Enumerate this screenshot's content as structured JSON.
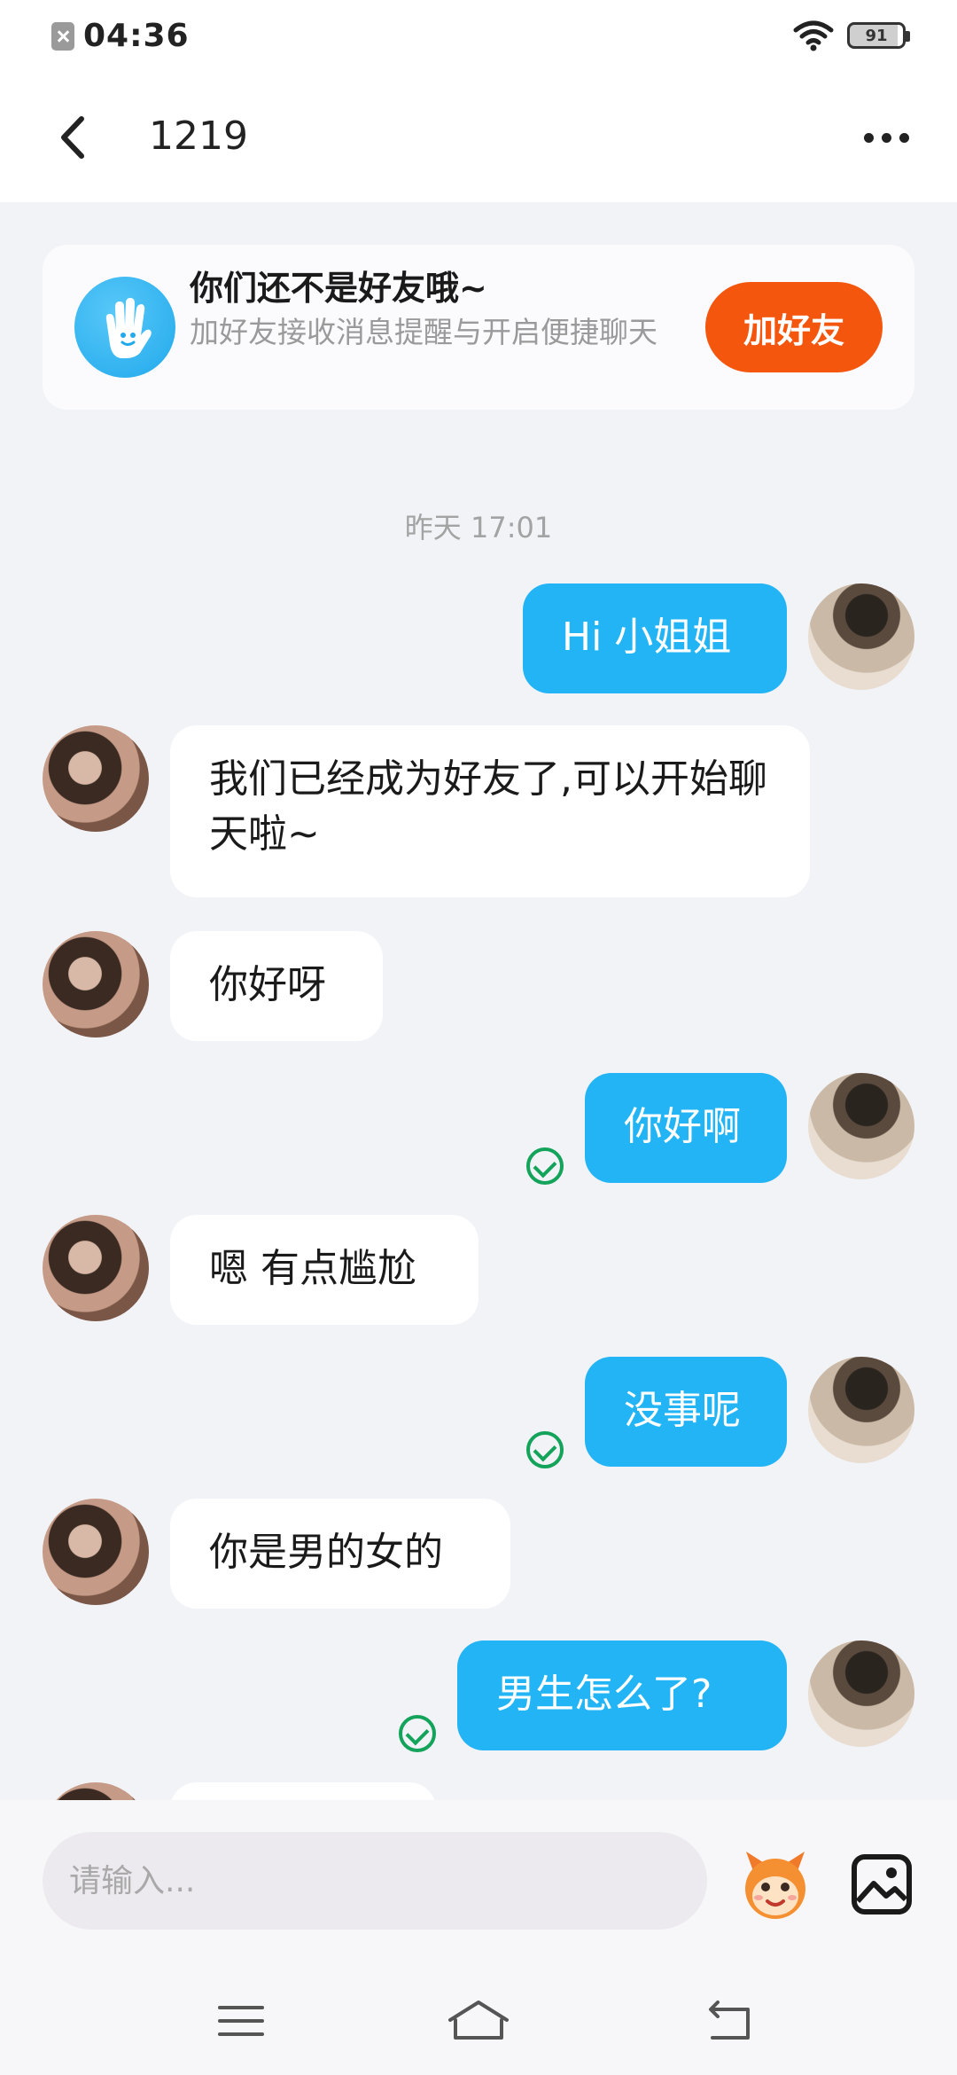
{
  "status_bar": {
    "time": "04:36",
    "battery": "91"
  },
  "header": {
    "title": "1219"
  },
  "friend_card": {
    "title": "你们还不是好友哦~",
    "description": "加好友接收消息提醒与开启便捷聊天",
    "button_label": "加好友"
  },
  "chat": {
    "timestamp": "昨天 17:01",
    "messages": [
      {
        "sender": "me",
        "text": "Hi  小姐姐",
        "read": false
      },
      {
        "sender": "her",
        "text": "我们已经成为好友了,可以开始聊天啦~"
      },
      {
        "sender": "her",
        "text": "你好呀"
      },
      {
        "sender": "me",
        "text": "你好啊",
        "read": true
      },
      {
        "sender": "her",
        "text": "嗯 有点尴尬"
      },
      {
        "sender": "me",
        "text": "没事呢",
        "read": true
      },
      {
        "sender": "her",
        "text": "你是男的女的"
      },
      {
        "sender": "me",
        "text": "男生怎么了?",
        "read": true
      }
    ]
  },
  "input": {
    "placeholder": "请输入..."
  },
  "colors": {
    "accent": "#22b4f5",
    "add_button": "#f4560e",
    "read_check": "#14a35a"
  }
}
